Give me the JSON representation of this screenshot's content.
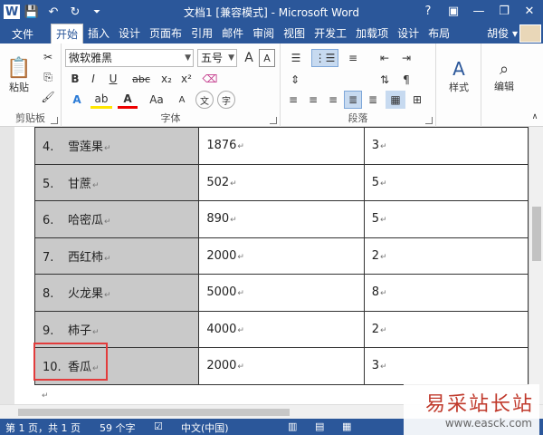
{
  "window": {
    "title": "文档1 [兼容模式] - Microsoft Word",
    "help": "?",
    "minimize": "—",
    "restore": "❐",
    "close": "✕"
  },
  "qat": {
    "save": "💾",
    "undo": "↶",
    "redo": "↻",
    "more": "⏷"
  },
  "tabs": {
    "file": "文件",
    "items": [
      "开始",
      "插入",
      "设计",
      "页面布",
      "引用",
      "邮件",
      "审阅",
      "视图",
      "开发工",
      "加载项",
      "设计",
      "布局"
    ],
    "user": "胡俊 ▾"
  },
  "ribbon": {
    "clipboard": {
      "label": "剪贴板",
      "paste": "粘贴"
    },
    "font": {
      "label": "字体",
      "font_name": "微软雅黑",
      "font_size": "五号",
      "bold": "B",
      "italic": "I",
      "underline": "U",
      "strike": "abc",
      "sub": "x₂",
      "sup": "x²",
      "grow": "A",
      "shrink": "A",
      "color": "A",
      "case": "Aa",
      "phonetic": "文",
      "enclose": "字"
    },
    "paragraph": {
      "label": "段落"
    },
    "styles": {
      "label": "样式"
    },
    "editing": {
      "label": "编辑"
    }
  },
  "table": {
    "rows": [
      {
        "num": "4.",
        "name": "雪莲果",
        "value": "1876",
        "count": "3"
      },
      {
        "num": "5.",
        "name": "甘蔗",
        "value": "502",
        "count": "5"
      },
      {
        "num": "6.",
        "name": "哈密瓜",
        "value": "890",
        "count": "5"
      },
      {
        "num": "7.",
        "name": "西红柿",
        "value": "2000",
        "count": "2"
      },
      {
        "num": "8.",
        "name": "火龙果",
        "value": "5000",
        "count": "8"
      },
      {
        "num": "9.",
        "name": "柿子",
        "value": "4000",
        "count": "2"
      },
      {
        "num": "10.",
        "name": "香瓜",
        "value": "2000",
        "count": "3"
      }
    ],
    "para_mark": "↵"
  },
  "status": {
    "page": "第 1 页，共 1 页",
    "words": "59 个字",
    "lang": "中文(中国)"
  },
  "watermark": {
    "line1": "易采站长站",
    "line2": "www.easck.com"
  },
  "colors": {
    "accent": "#2b579a",
    "selection_box": "#e23c3c",
    "cell_shade": "#c9c9c9"
  }
}
